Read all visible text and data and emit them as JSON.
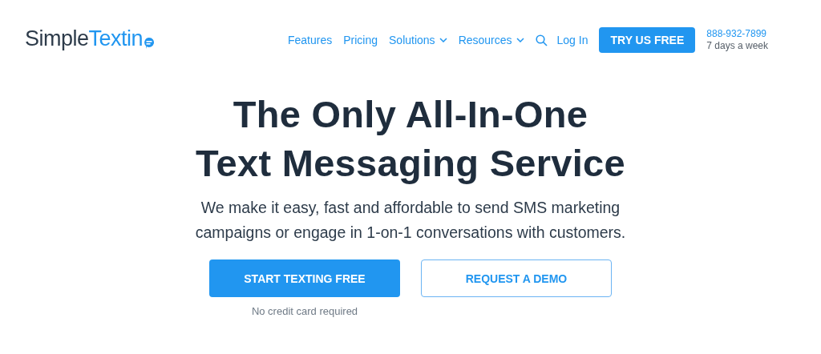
{
  "logo": {
    "first": "Simple",
    "second": "Textin"
  },
  "nav": [
    {
      "label": "Features",
      "kind": "link"
    },
    {
      "label": "Pricing",
      "kind": "link"
    },
    {
      "label": "Solutions",
      "kind": "dropdown"
    },
    {
      "label": "Resources",
      "kind": "dropdown"
    }
  ],
  "login": "Log In",
  "cta": "TRY US FREE",
  "phone": "888-932-7899",
  "hours": "7 days a week",
  "hero": {
    "title_lines": [
      "The Only All-In-One",
      "Text Messaging Service"
    ],
    "subtitle_lines": [
      "We make it easy, fast and affordable to send SMS marketing",
      "campaigns or engage in 1-on-1 conversations with customers."
    ],
    "buttons": [
      {
        "label": "START TEXTING FREE",
        "kind": "primary"
      },
      {
        "label": "REQUEST A DEMO",
        "kind": "outline"
      }
    ],
    "note": "No credit card required"
  }
}
